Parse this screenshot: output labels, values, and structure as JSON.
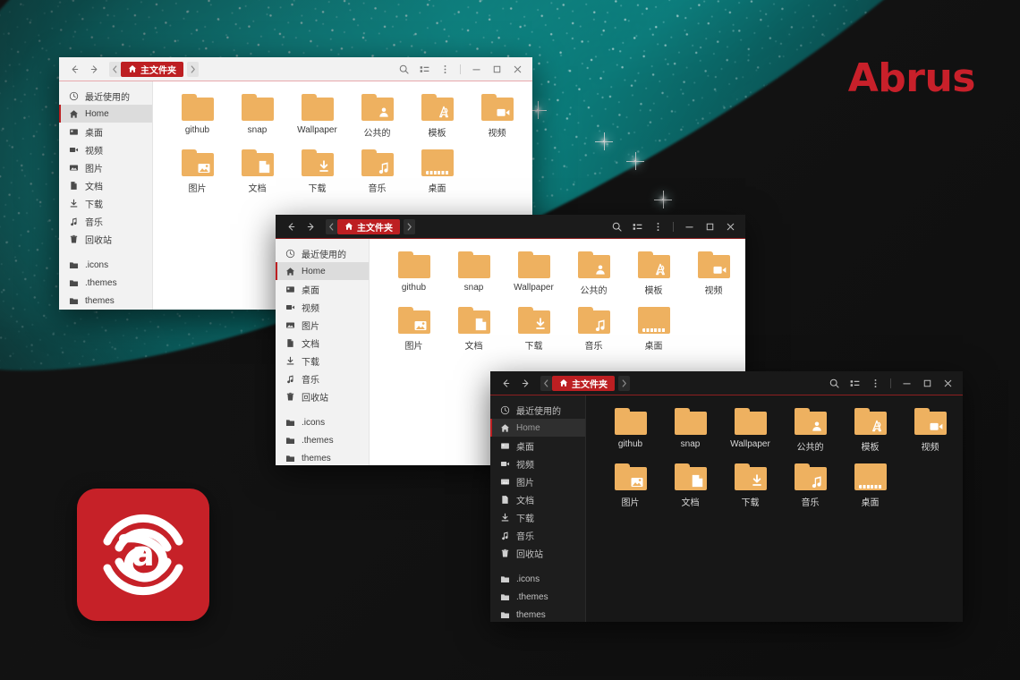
{
  "desktop": {
    "brand_text": "Abrus",
    "brand_color": "#c8202a",
    "wallpaper_accent": "#0fa8a4",
    "background_color": "#141414",
    "app_logo": {
      "name": "abrus-logo",
      "background_color": "#c62128",
      "letter": "a"
    }
  },
  "shared": {
    "titlebar": {
      "back_icon": "arrow-left-icon",
      "forward_icon": "arrow-right-icon",
      "crumb_prev_icon": "chevron-left-icon",
      "crumb_next_icon": "chevron-right-icon",
      "home_icon": "home-icon",
      "path_label": "主文件夹",
      "search_icon": "search-icon",
      "view_icon": "list-view-icon",
      "menu_icon": "more-vertical-icon",
      "minimize_icon": "minimize-icon",
      "maximize_icon": "maximize-icon",
      "close_icon": "close-icon",
      "accent_color": "#bd1f22"
    },
    "sidebar": {
      "items": [
        {
          "label": "最近使用的",
          "icon": "clock-icon",
          "active": false
        },
        {
          "label": "Home",
          "icon": "home-icon",
          "active": true
        },
        {
          "label": "桌面",
          "icon": "desktop-icon",
          "active": false
        },
        {
          "label": "视频",
          "icon": "video-icon",
          "active": false
        },
        {
          "label": "图片",
          "icon": "image-icon",
          "active": false
        },
        {
          "label": "文档",
          "icon": "document-icon",
          "active": false
        },
        {
          "label": "下载",
          "icon": "download-icon",
          "active": false
        },
        {
          "label": "音乐",
          "icon": "music-icon",
          "active": false
        },
        {
          "label": "回收站",
          "icon": "trash-icon",
          "active": false
        }
      ],
      "extra_items": [
        {
          "label": ".icons",
          "icon": "folder-icon"
        },
        {
          "label": ".themes",
          "icon": "folder-icon"
        },
        {
          "label": "themes",
          "icon": "folder-icon"
        }
      ]
    },
    "files": [
      {
        "label": "github",
        "icon": "folder-plain-icon"
      },
      {
        "label": "snap",
        "icon": "folder-plain-icon"
      },
      {
        "label": "Wallpaper",
        "icon": "folder-plain-icon"
      },
      {
        "label": "公共的",
        "icon": "folder-public-icon"
      },
      {
        "label": "模板",
        "icon": "folder-templates-icon"
      },
      {
        "label": "视频",
        "icon": "folder-videos-icon"
      },
      {
        "label": "图片",
        "icon": "folder-pictures-icon"
      },
      {
        "label": "文档",
        "icon": "folder-documents-icon"
      },
      {
        "label": "下载",
        "icon": "folder-downloads-icon"
      },
      {
        "label": "音乐",
        "icon": "folder-music-icon"
      },
      {
        "label": "桌面",
        "icon": "folder-desktop-icon"
      }
    ],
    "folder_color": "#eeb160"
  },
  "windows": [
    {
      "id": "window-light",
      "theme": "light",
      "title": "主文件夹"
    },
    {
      "id": "window-mixed",
      "theme": "mixed",
      "title": "主文件夹"
    },
    {
      "id": "window-dark",
      "theme": "dark",
      "title": "主文件夹"
    }
  ]
}
